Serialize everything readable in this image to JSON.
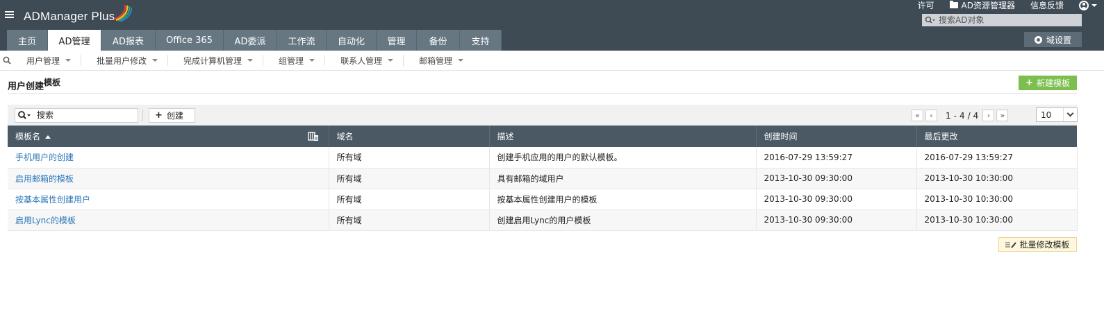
{
  "app": {
    "name": "ADManager Plus"
  },
  "top_links": {
    "license": "许可",
    "ad_explorer": "AD资源管理器",
    "feedback": "信息反馈"
  },
  "global_search": {
    "placeholder": "搜索AD对象"
  },
  "domain_settings_label": "域设置",
  "tabs": [
    {
      "label": "主页",
      "active": false
    },
    {
      "label": "AD管理",
      "active": true
    },
    {
      "label": "AD报表",
      "active": false
    },
    {
      "label": "Office 365",
      "active": false
    },
    {
      "label": "AD委派",
      "active": false
    },
    {
      "label": "工作流",
      "active": false
    },
    {
      "label": "自动化",
      "active": false
    },
    {
      "label": "管理",
      "active": false
    },
    {
      "label": "备份",
      "active": false
    },
    {
      "label": "支持",
      "active": false
    }
  ],
  "submenu": [
    {
      "label": "用户管理"
    },
    {
      "label": "批量用户修改"
    },
    {
      "label": "完成计算机管理"
    },
    {
      "label": "组管理"
    },
    {
      "label": "联系人管理"
    },
    {
      "label": "邮箱管理"
    }
  ],
  "page": {
    "title": "用户创建",
    "title_sup": "模板",
    "new_template_label": "新建模板",
    "bulk_modify_label": "批量修改模板"
  },
  "toolbar": {
    "search_placeholder": "搜索",
    "create_label": "创建",
    "pager": {
      "start": "1",
      "sep": "-",
      "end": "4",
      "slash": "/",
      "total": "4"
    },
    "page_size": "10"
  },
  "table": {
    "columns": [
      "模板名",
      "域名",
      "描述",
      "创建时间",
      "最后更改"
    ],
    "sort_column": "模板名",
    "sort_dir": "asc",
    "rows": [
      [
        "手机用户的创建",
        "所有域",
        "创建手机应用的用户的默认模板。",
        "2016-07-29 13:59:27",
        "2016-07-29 13:59:27"
      ],
      [
        "启用邮箱的模板",
        "所有域",
        "具有邮箱的域用户",
        "2013-10-30 09:30:00",
        "2013-10-30 10:30:00"
      ],
      [
        "按基本属性创建用户",
        "所有域",
        "按基本属性创建用户的模板",
        "2013-10-30 09:30:00",
        "2013-10-30 10:30:00"
      ],
      [
        "启用Lync的模板",
        "所有域",
        "创建启用Lync的用户模板",
        "2013-10-30 09:30:00",
        "2013-10-30 10:30:00"
      ]
    ]
  },
  "colors": {
    "header_bg": "#3e4a54",
    "tab_bg": "#667782",
    "table_header_bg": "#4b5964",
    "link": "#2b77b8",
    "primary_green": "#7cbf4f"
  }
}
